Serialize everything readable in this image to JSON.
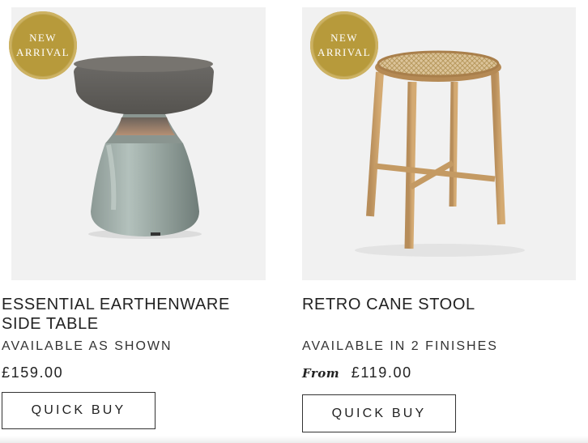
{
  "products": [
    {
      "badge": {
        "line1": "NEW",
        "line2": "ARRIVAL"
      },
      "title": "ESSENTIAL EARTHENWARE SIDE TABLE",
      "availability": "AVAILABLE AS SHOWN",
      "price_prefix": "",
      "price": "£159.00",
      "button_label": "QUICK BUY"
    },
    {
      "badge": {
        "line1": "NEW",
        "line2": "ARRIVAL"
      },
      "title": "RETRO CANE STOOL",
      "availability": "AVAILABLE IN 2 FINISHES",
      "price_prefix": "From",
      "price": "£119.00",
      "button_label": "QUICK BUY"
    }
  ],
  "colors": {
    "badge_gold": "#b79a3b",
    "image_background": "#f1f1f1",
    "text": "#222222"
  }
}
